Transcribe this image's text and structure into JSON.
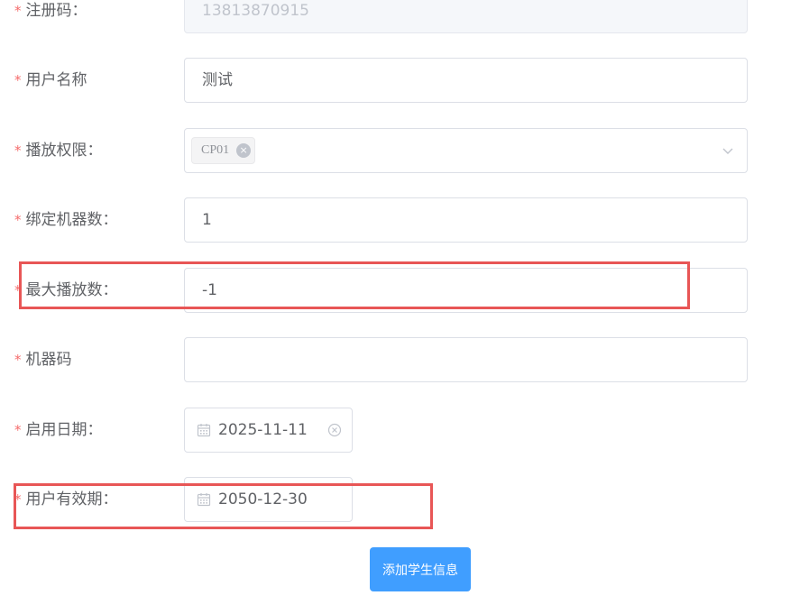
{
  "form": {
    "required_mark": "*",
    "registration_code": {
      "label": "注册码：",
      "value": "13813870915"
    },
    "user_name": {
      "label": "用户名称",
      "value": "测试"
    },
    "play_permission": {
      "label": "播放权限：",
      "tag": "CP01",
      "tag_close": "×"
    },
    "bound_machines": {
      "label": "绑定机器数：",
      "value": "1"
    },
    "max_plays": {
      "label": "最大播放数：",
      "value": "-1"
    },
    "machine_code": {
      "label": "机器码",
      "value": ""
    },
    "start_date": {
      "label": "启用日期：",
      "value": "2025-11-11"
    },
    "expiry_date": {
      "label": "用户有效期：",
      "value": "2050-12-30"
    }
  },
  "submit_button": {
    "label": "添加学生信息"
  },
  "colors": {
    "required": "#f56c6c",
    "highlight": "#e85656",
    "primary": "#409eff",
    "border": "#dcdfe6",
    "disabled_bg": "#f5f7fa"
  }
}
